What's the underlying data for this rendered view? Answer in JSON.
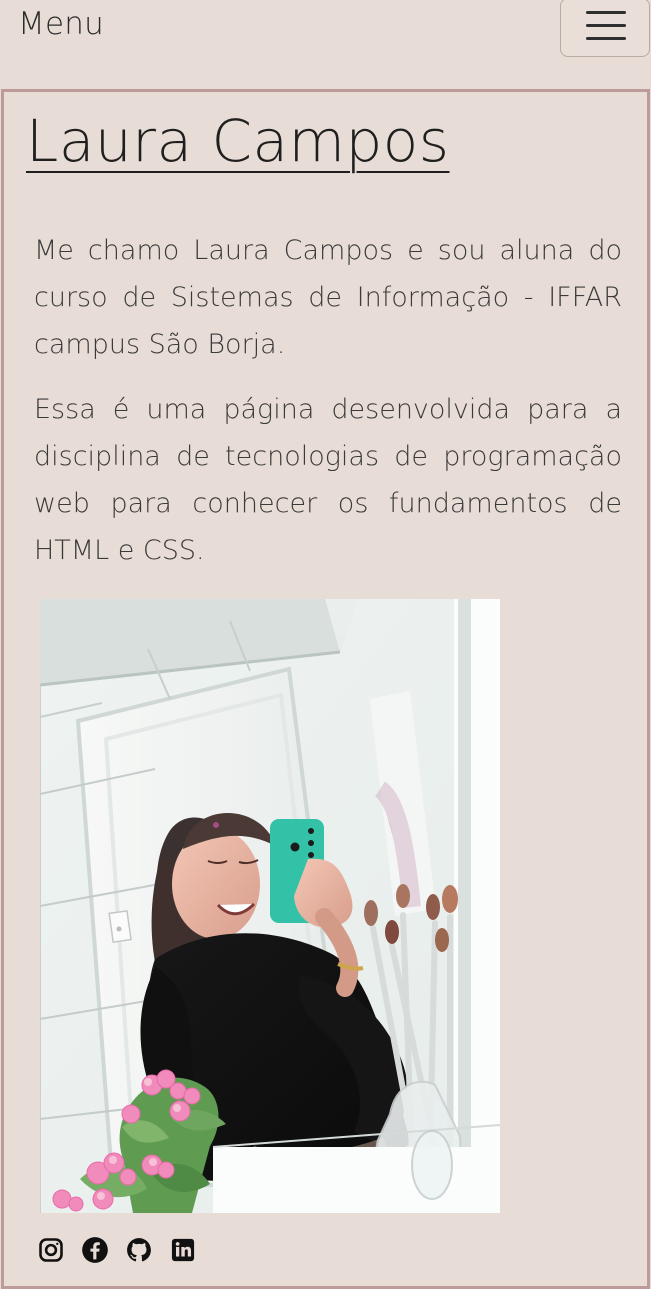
{
  "header": {
    "menu_label": "Menu",
    "menu_button_icon": "hamburger-icon"
  },
  "profile": {
    "name": "Laura Campos",
    "paragraphs": [
      "Me chamo Laura Campos e sou aluna do curso de Sistemas de Informação - IFFAR campus São Borja.",
      "Essa é uma página desenvolvida para a disciplina de tecnologias de programação web para conhecer os fundamentos de HTML e CSS."
    ],
    "photo_icon": "profile-photo"
  },
  "social": [
    {
      "icon": "instagram-icon"
    },
    {
      "icon": "facebook-icon"
    },
    {
      "icon": "github-icon"
    },
    {
      "icon": "linkedin-icon"
    }
  ],
  "colors": {
    "background": "#e8ddd6",
    "panel_border": "#bc9b9a",
    "text": "#2a2a2a",
    "phone_case": "#33c1a7",
    "flowers": "#f08bbc"
  }
}
